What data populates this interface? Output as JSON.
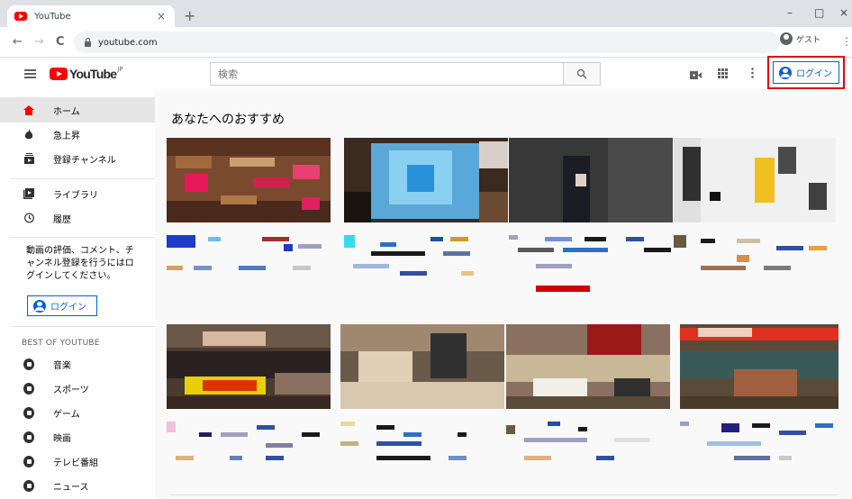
{
  "browser": {
    "tab_title": "YouTube",
    "tab_close": "×",
    "new_tab": "+",
    "win_minimize": "–",
    "win_maximize": "□",
    "win_close": "×",
    "back": "←",
    "forward": "→",
    "reload": "C",
    "url": "youtube.com",
    "profile_label": "ゲスト",
    "menu": "⋮"
  },
  "masthead": {
    "logo_text": "YouTube",
    "logo_region": "JP",
    "search_placeholder": "検索",
    "apps_icon": "apps-icon",
    "login_label": "ログイン"
  },
  "sidebar": {
    "items": [
      {
        "label": "ホーム",
        "icon": "home-icon",
        "active": true
      },
      {
        "label": "急上昇",
        "icon": "trending-icon"
      },
      {
        "label": "登録チャンネル",
        "icon": "subscriptions-icon"
      },
      {
        "label": "ライブラリ",
        "icon": "library-icon"
      },
      {
        "label": "履歴",
        "icon": "history-icon"
      }
    ],
    "message": "動画の評価、コメント、チャンネル登録を行うにはログインしてください。",
    "login_label": "ログイン",
    "best_heading": "BEST OF YOUTUBE",
    "categories": [
      {
        "label": "音楽",
        "icon": "music-icon"
      },
      {
        "label": "スポーツ",
        "icon": "sports-icon"
      },
      {
        "label": "ゲーム",
        "icon": "gaming-icon"
      },
      {
        "label": "映画",
        "icon": "movies-icon"
      },
      {
        "label": "テレビ番組",
        "icon": "tv-icon"
      },
      {
        "label": "ニュース",
        "icon": "news-icon"
      }
    ]
  },
  "main": {
    "section_title": "あなたへのおすすめ"
  },
  "colors": {
    "accent_blue": "#065fd4",
    "brand_red": "#ff0000",
    "highlight_box": "#e30000"
  }
}
